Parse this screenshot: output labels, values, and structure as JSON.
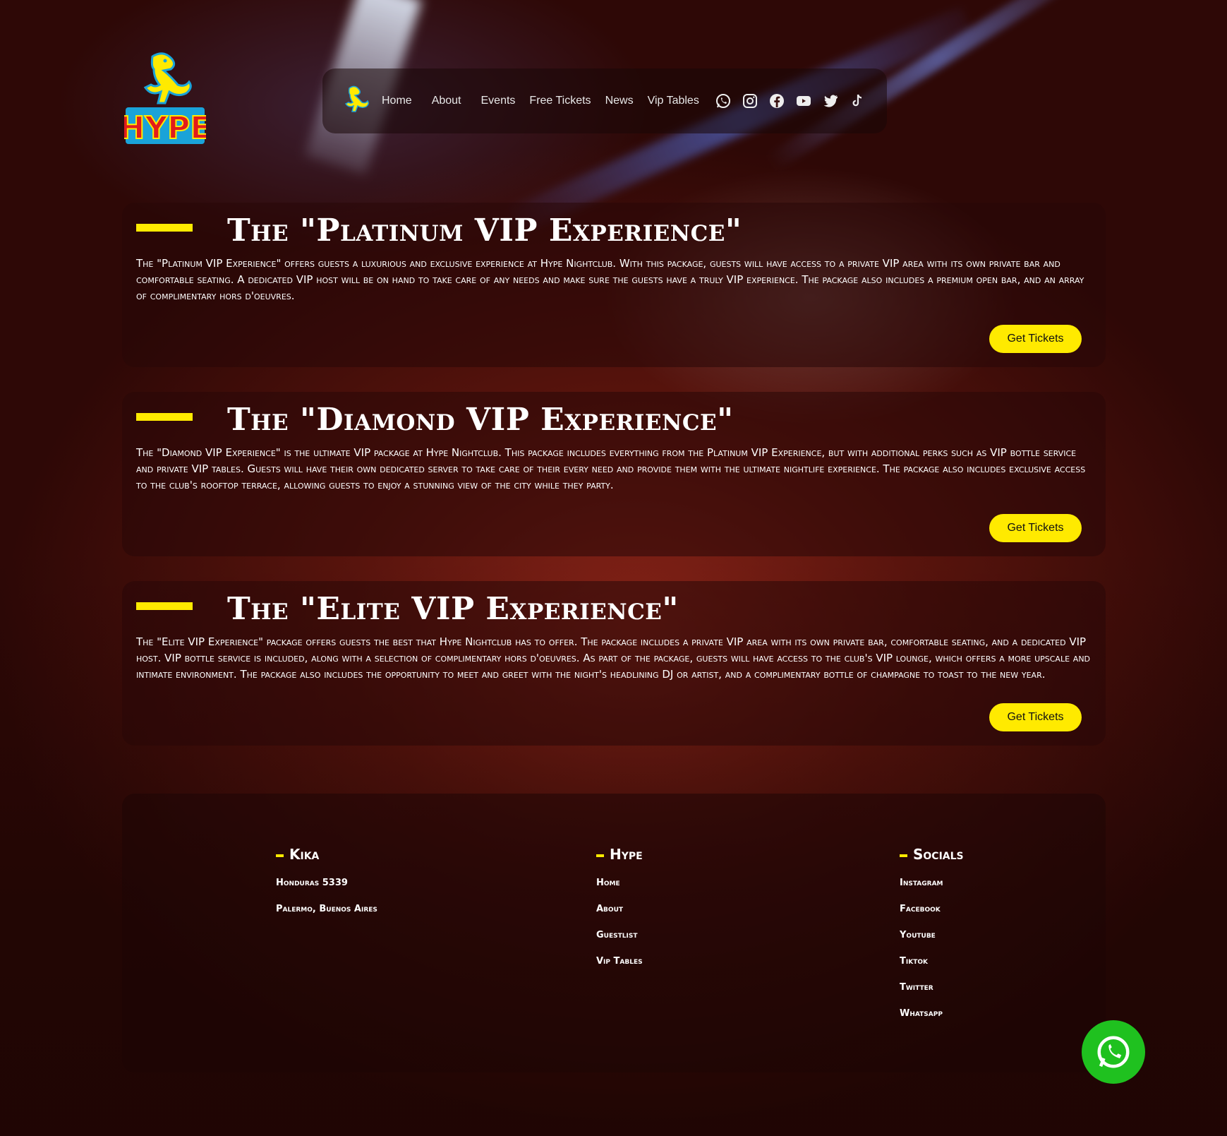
{
  "nav": {
    "links": [
      "Home",
      "About",
      "Events",
      "Free Tickets",
      "News",
      "Vip Tables"
    ],
    "icons": [
      "whatsapp-icon",
      "instagram-icon",
      "facebook-icon",
      "youtube-icon",
      "twitter-icon",
      "tiktok-icon"
    ]
  },
  "logo": {
    "text": "HYPE"
  },
  "colors": {
    "accent": "#ffea00",
    "whatsapp": "#1fc11f"
  },
  "cards": [
    {
      "title": "The \"Platinum VIP Experience\"",
      "body": "The \"Platinum VIP Experience\" offers guests a luxurious and exclusive experience at Hype Nightclub. With this package, guests will have access to a private VIP area with its own private bar and comfortable seating. A dedicated VIP host will be on hand to take care of any needs and make sure the guests have a truly VIP experience. The package also includes a premium open bar, and an array of complimentary hors d'oeuvres.",
      "button": "Get Tickets"
    },
    {
      "title": "The \"Diamond VIP Experience\"",
      "body": "The \"Diamond VIP Experience\" is the ultimate VIP package at Hype Nightclub. This package includes everything from the Platinum VIP Experience, but with additional perks such as VIP bottle service and private VIP tables. Guests will have their own dedicated server to take care of their every need and provide them with the ultimate nightlife experience. The package also includes exclusive access to the club's rooftop terrace, allowing guests to enjoy a stunning view of the city while they party.",
      "button": "Get Tickets"
    },
    {
      "title": "The \"Elite VIP Experience\"",
      "body": "The \"Elite VIP Experience\" package offers guests the best that Hype Nightclub has to offer. The package includes a private VIP area with its own private bar, comfortable seating, and a dedicated VIP host. VIP bottle service is included, along with a selection of complimentary hors d'oeuvres. As part of the package, guests will have access to the club's VIP lounge, which offers a more upscale and intimate environment. The package also includes the opportunity to meet and greet with the night's headlining DJ or artist, and a complimentary bottle of champagne to toast to the new year.",
      "button": "Get Tickets"
    }
  ],
  "footer": {
    "kika": {
      "title": "Kika",
      "items": [
        "Honduras 5339",
        "Palermo, Buenos Aires"
      ]
    },
    "hype": {
      "title": "Hype",
      "items": [
        "Home",
        "About",
        "Guestlist",
        "Vip Tables"
      ]
    },
    "socials": {
      "title": "Socials",
      "items": [
        "Instagram",
        "Facebook",
        "Youtube",
        "Tiktok",
        "Twitter",
        "Whatsapp"
      ]
    }
  }
}
